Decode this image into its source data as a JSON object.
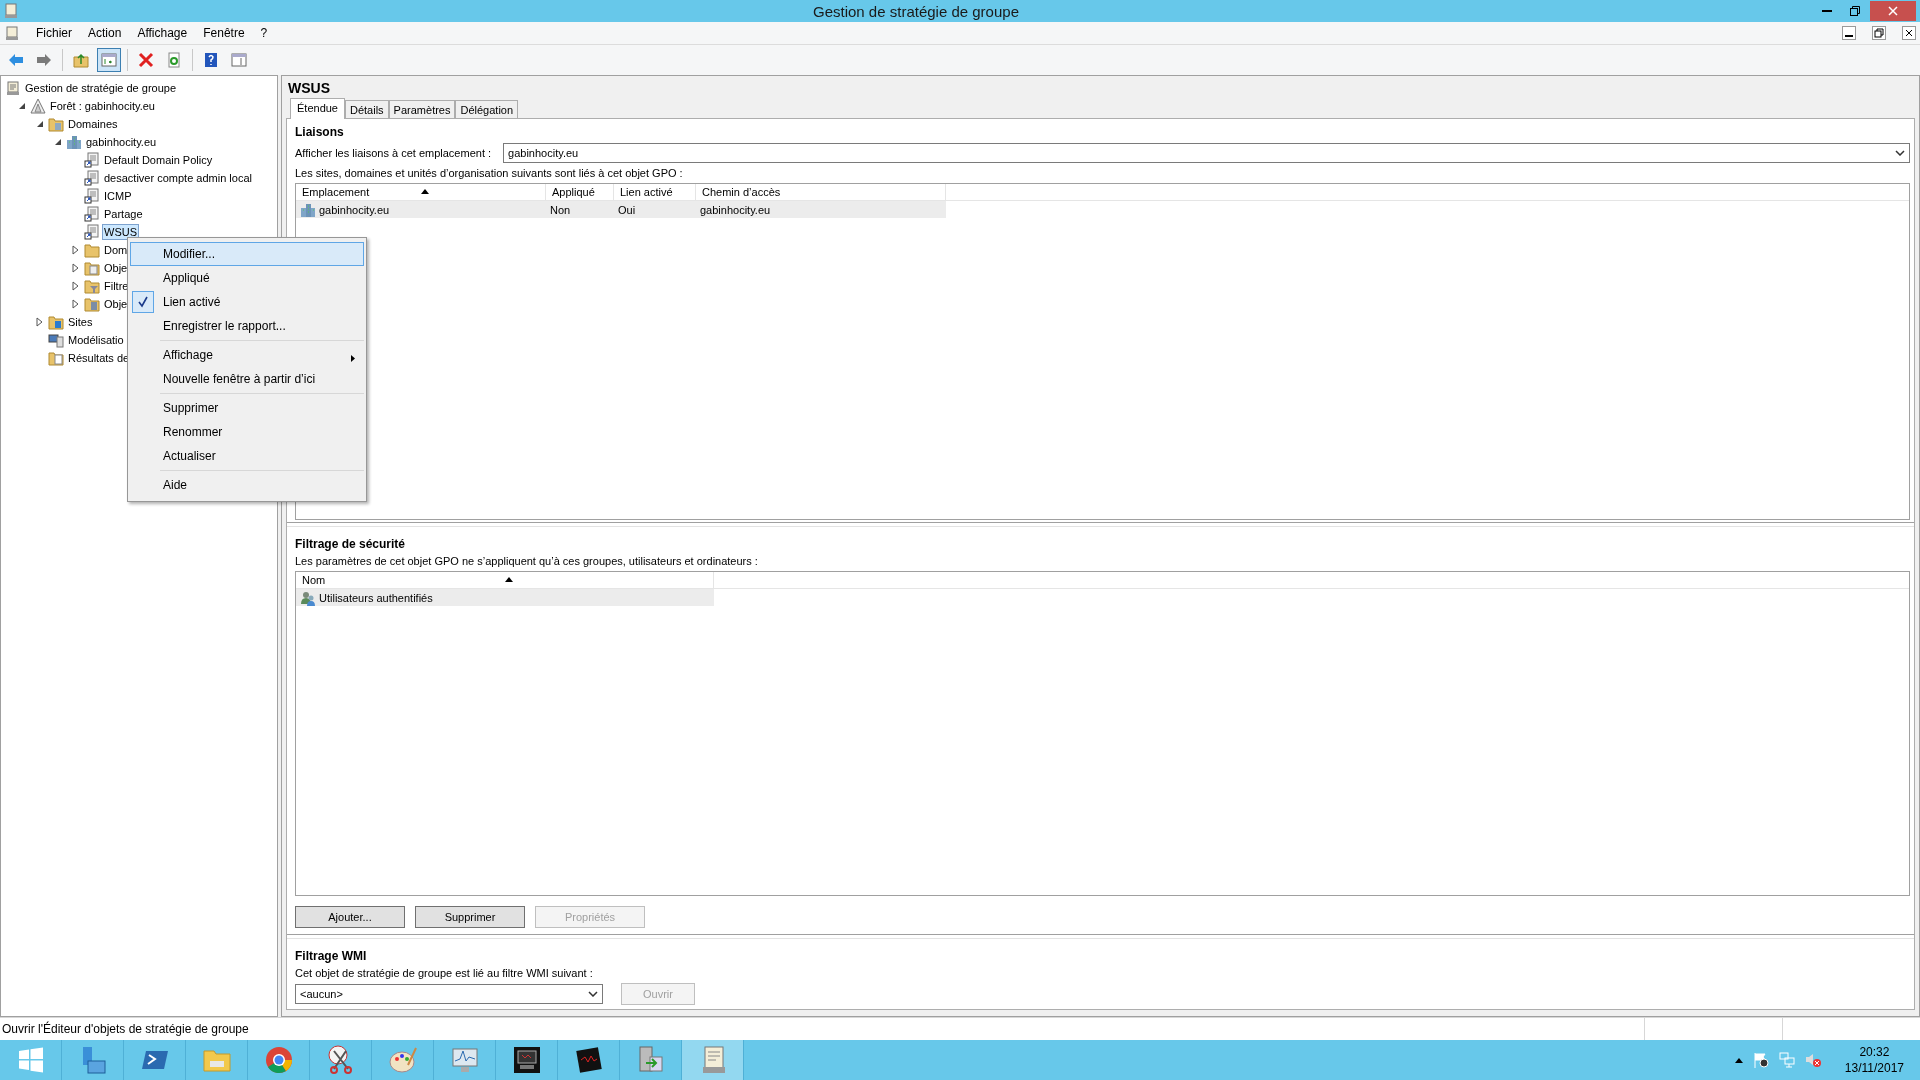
{
  "window": {
    "title": "Gestion de stratégie de groupe"
  },
  "menu": [
    "Fichier",
    "Action",
    "Affichage",
    "Fenêtre",
    "?"
  ],
  "toolbar": [
    {
      "kind": "back",
      "pressed": false
    },
    {
      "kind": "forward",
      "pressed": false
    },
    {
      "kind": "sep"
    },
    {
      "kind": "up",
      "pressed": false
    },
    {
      "kind": "tree",
      "pressed": true
    },
    {
      "kind": "sep"
    },
    {
      "kind": "delete",
      "pressed": false
    },
    {
      "kind": "refresh",
      "pressed": false
    },
    {
      "kind": "sep"
    },
    {
      "kind": "help",
      "pressed": false
    },
    {
      "kind": "panel",
      "pressed": false
    }
  ],
  "tree": [
    {
      "label": "Gestion de stratégie de groupe",
      "kind": "console",
      "selected": false,
      "children": [
        {
          "label": "Forêt : gabinhocity.eu",
          "kind": "forest",
          "selected": false,
          "expanded": true,
          "children": [
            {
              "label": "Domaines",
              "kind": "domains",
              "selected": false,
              "expanded": true,
              "children": [
                {
                  "label": "gabinhocity.eu",
                  "kind": "domain",
                  "selected": false,
                  "expanded": true,
                  "children": [
                    {
                      "label": "Default Domain Policy",
                      "kind": "gpo",
                      "selected": false
                    },
                    {
                      "label": "desactiver compte admin local",
                      "kind": "gpo",
                      "selected": false
                    },
                    {
                      "label": "ICMP",
                      "kind": "gpo",
                      "selected": false
                    },
                    {
                      "label": "Partage",
                      "kind": "gpo",
                      "selected": false
                    },
                    {
                      "label": "WSUS",
                      "kind": "gpo",
                      "selected": true
                    },
                    {
                      "label": "Dom",
                      "kind": "folder",
                      "selected": false,
                      "expanded": false
                    },
                    {
                      "label": "Obje",
                      "kind": "gpofolder",
                      "selected": false,
                      "expanded": false
                    },
                    {
                      "label": "Filtre",
                      "kind": "filter",
                      "selected": false,
                      "expanded": false
                    },
                    {
                      "label": "Obje",
                      "kind": "starter",
                      "selected": false,
                      "expanded": false
                    }
                  ]
                }
              ]
            },
            {
              "label": "Sites",
              "kind": "sites",
              "selected": false,
              "expanded": false
            },
            {
              "label": "Modélisatio",
              "kind": "modeling",
              "selected": false
            },
            {
              "label": "Résultats de",
              "kind": "results",
              "selected": false
            }
          ]
        }
      ]
    }
  ],
  "context_menu": [
    [
      {
        "label": "Modifier...",
        "selected": true,
        "checked": false
      },
      {
        "label": "Appliqué",
        "selected": false,
        "checked": false
      },
      {
        "label": "Lien activé",
        "selected": false,
        "checked": true
      },
      {
        "label": "Enregistrer le rapport...",
        "selected": false,
        "checked": false
      }
    ],
    [
      {
        "label": "Affichage",
        "selected": false,
        "checked": false,
        "submenu": true
      },
      {
        "label": "Nouvelle fenêtre à partir d’ici",
        "selected": false,
        "checked": false
      }
    ],
    [
      {
        "label": "Supprimer",
        "selected": false,
        "checked": false
      },
      {
        "label": "Renommer",
        "selected": false,
        "checked": false
      },
      {
        "label": "Actualiser",
        "selected": false,
        "checked": false
      }
    ],
    [
      {
        "label": "Aide",
        "selected": false,
        "checked": false
      }
    ]
  ],
  "details": {
    "title": "WSUS",
    "tabs": [
      {
        "label": "Étendue",
        "selected": true
      },
      {
        "label": "Détails",
        "selected": false
      },
      {
        "label": "Paramètres",
        "selected": false
      },
      {
        "label": "Délégation",
        "selected": false
      }
    ],
    "links": {
      "title": "Liaisons",
      "location_label": "Afficher les liaisons à cet emplacement :",
      "location_value": "gabinhocity.eu",
      "description": "Les sites, domaines et unités d’organisation suivants sont liés à cet objet GPO :",
      "columns": [
        {
          "label": "Emplacement",
          "sorted": true
        },
        {
          "label": "Appliqué",
          "sorted": false
        },
        {
          "label": "Lien activé",
          "sorted": false
        },
        {
          "label": "Chemin d’accès",
          "sorted": false
        }
      ],
      "rows": [
        [
          "gabinhocity.eu",
          "Non",
          "Oui",
          "gabinhocity.eu"
        ]
      ]
    },
    "security": {
      "title": "Filtrage de sécurité",
      "description": "Les paramètres de cet objet GPO ne s’appliquent qu’à ces groupes, utilisateurs et ordinateurs :",
      "columns": [
        {
          "label": "Nom",
          "sorted": true
        }
      ],
      "rows": [
        "Utilisateurs authentifiés"
      ],
      "buttons": [
        {
          "label": "Ajouter...",
          "disabled": false
        },
        {
          "label": "Supprimer",
          "disabled": false
        },
        {
          "label": "Propriétés",
          "disabled": true
        }
      ]
    },
    "wmi": {
      "title": "Filtrage WMI",
      "description": "Cet objet de stratégie de groupe est lié au filtre WMI suivant :",
      "value": "<aucun>",
      "button": {
        "label": "Ouvrir",
        "disabled": true
      }
    }
  },
  "status_bar": "Ouvrir l'Éditeur d'objets de stratégie de groupe",
  "taskbar": {
    "apps": [
      {
        "kind": "server",
        "active": false
      },
      {
        "kind": "powershell",
        "active": false
      },
      {
        "kind": "explorer",
        "active": false
      },
      {
        "kind": "browser",
        "active": false
      },
      {
        "kind": "scissors",
        "active": false
      },
      {
        "kind": "palette",
        "active": false
      },
      {
        "kind": "monitor",
        "active": false
      },
      {
        "kind": "terminal",
        "active": false
      },
      {
        "kind": "dark",
        "active": false
      },
      {
        "kind": "transfer",
        "active": false
      },
      {
        "kind": "console",
        "active": true
      }
    ],
    "time": "20:32",
    "date": "13/11/2017"
  }
}
